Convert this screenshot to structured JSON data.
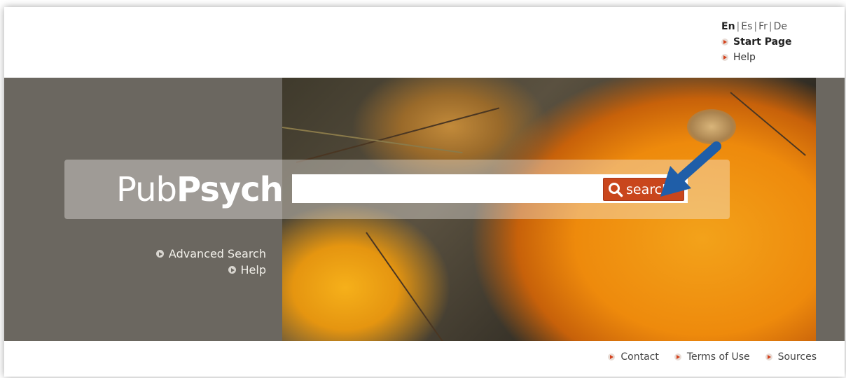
{
  "header": {
    "languages": [
      {
        "code": "En",
        "active": true
      },
      {
        "code": "Es",
        "active": false
      },
      {
        "code": "Fr",
        "active": false
      },
      {
        "code": "De",
        "active": false
      }
    ],
    "language_separator": "|",
    "links": {
      "start_page": "Start Page",
      "help": "Help"
    }
  },
  "logo": {
    "part1": "Pub",
    "part2": "Psych"
  },
  "search": {
    "value": "",
    "button_label": "search"
  },
  "side_links": {
    "advanced_search": "Advanced Search",
    "help": "Help"
  },
  "footer": {
    "contact": "Contact",
    "terms": "Terms of Use",
    "sources": "Sources"
  },
  "colors": {
    "banner_bg": "#6b6760",
    "accent": "#c9461c",
    "pointer_arrow": "#1f5ea8"
  },
  "icons": {
    "search_button": "magnifier-icon",
    "link_bullet": "arrow-right-icon",
    "overlay": "pointer-arrow-icon"
  }
}
